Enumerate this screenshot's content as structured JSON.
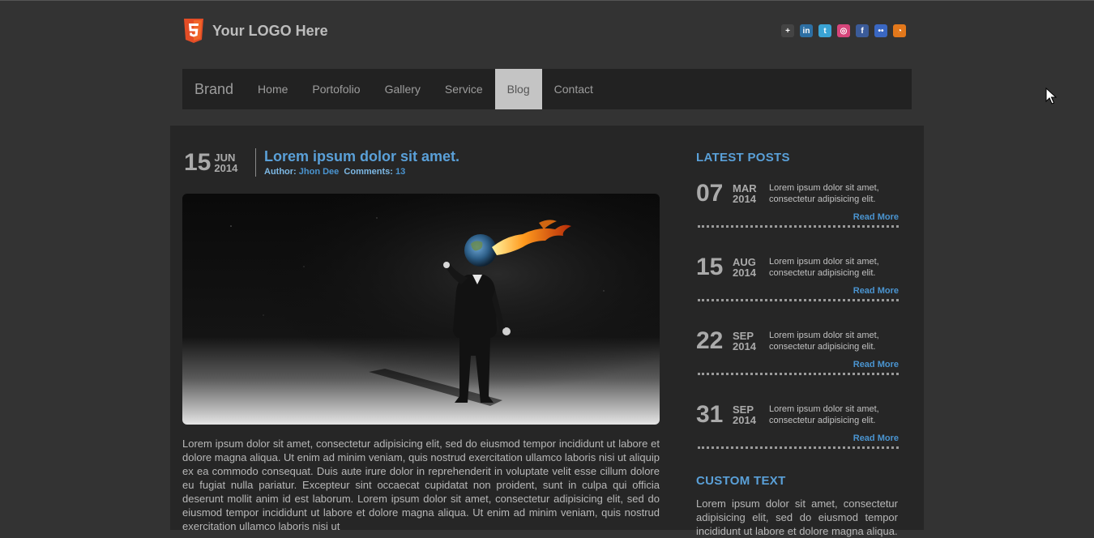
{
  "header": {
    "logo_text": "Your LOGO Here",
    "logo_icon": "html5-shield-icon",
    "social_icons": [
      {
        "name": "google-plus-icon",
        "glyph": "+",
        "color": "#444444"
      },
      {
        "name": "linkedin-icon",
        "glyph": "in",
        "color": "#2d6fa3"
      },
      {
        "name": "twitter-icon",
        "glyph": "t",
        "color": "#3aa3d4"
      },
      {
        "name": "dribbble-icon",
        "glyph": "◎",
        "color": "#d6457a"
      },
      {
        "name": "facebook-icon",
        "glyph": "f",
        "color": "#3b5b99"
      },
      {
        "name": "flickr-icon",
        "glyph": "••",
        "color": "#3a67c2"
      },
      {
        "name": "rss-icon",
        "glyph": "◔",
        "color": "#e3781b"
      }
    ]
  },
  "nav": {
    "brand": "Brand",
    "items": [
      "Home",
      "Portofolio",
      "Gallery",
      "Service",
      "Blog",
      "Contact"
    ],
    "active_index": 4
  },
  "post": {
    "day": "15",
    "month": "JUN",
    "year": "2014",
    "title": "Lorem ipsum dolor sit amet.",
    "author_label": "Author:",
    "author": "Jhon Dee",
    "comments_label": "Comments:",
    "comments": "13",
    "body": "Lorem ipsum dolor sit amet, consectetur adipisicing elit, sed do eiusmod tempor incididunt ut labore et dolore magna aliqua. Ut enim ad minim veniam, quis nostrud exercitation ullamco laboris nisi ut aliquip ex ea commodo consequat. Duis aute irure dolor in reprehenderit in voluptate velit esse cillum dolore eu fugiat nulla pariatur. Excepteur sint occaecat cupidatat non proident, sunt in culpa qui officia deserunt mollit anim id est laborum. Lorem ipsum dolor sit amet, consectetur adipisicing elit, sed do eiusmod tempor incididunt ut labore et dolore magna aliqua. Ut enim ad minim veniam, quis nostrud exercitation ullamco laboris nisi ut"
  },
  "sidebar": {
    "latest_title": "LATEST POSTS",
    "latest_posts": [
      {
        "day": "07",
        "month": "MAR",
        "year": "2014",
        "text": "Lorem ipsum dolor sit amet, consectetur adipisicing elit.",
        "read_more": "Read More"
      },
      {
        "day": "15",
        "month": "AUG",
        "year": "2014",
        "text": "Lorem ipsum dolor sit amet, consectetur adipisicing elit.",
        "read_more": "Read More"
      },
      {
        "day": "22",
        "month": "SEP",
        "year": "2014",
        "text": "Lorem ipsum dolor sit amet, consectetur adipisicing elit.",
        "read_more": "Read More"
      },
      {
        "day": "31",
        "month": "SEP",
        "year": "2014",
        "text": "Lorem ipsum dolor sit amet, consectetur adipisicing elit.",
        "read_more": "Read More"
      }
    ],
    "custom_title": "CUSTOM TEXT",
    "custom_text": "Lorem ipsum dolor sit amet, consectetur adipisicing elit, sed do eiusmod tempor incididunt ut labore et dolore magna aliqua."
  },
  "colors": {
    "page_bg": "#333333",
    "panel_bg": "#262626",
    "nav_bg": "#222222",
    "nav_active_bg": "#c4c4c4",
    "accent": "#5aa0d8",
    "link": "#4a94d0",
    "logo_orange": "#e44d26"
  }
}
